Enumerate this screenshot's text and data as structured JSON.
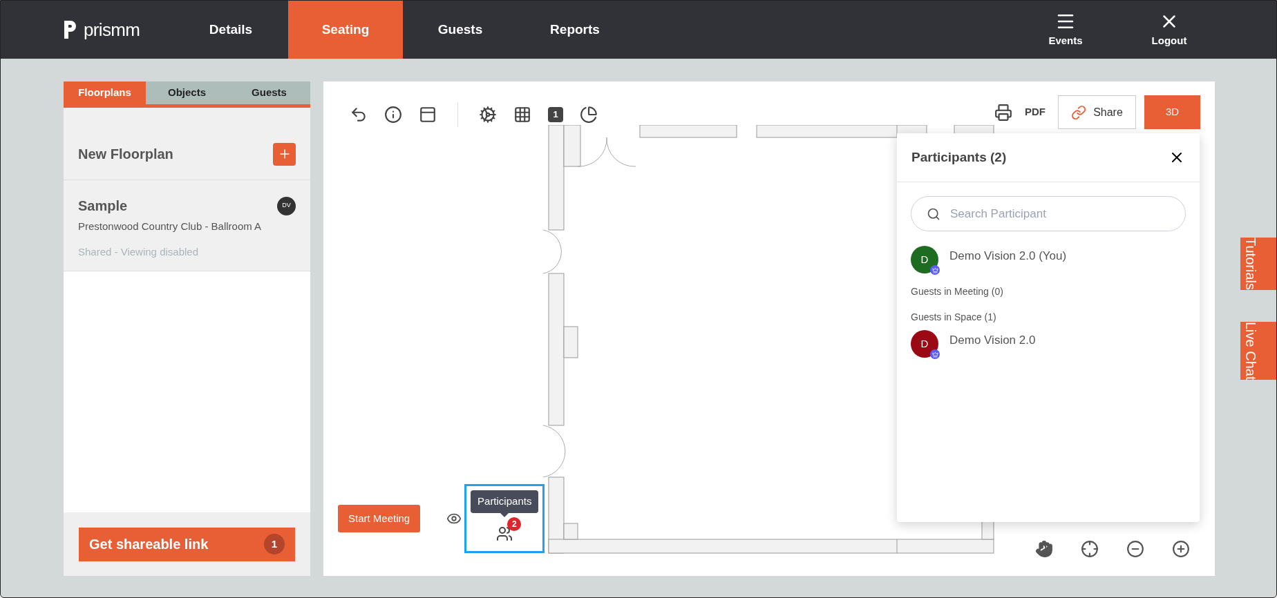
{
  "header": {
    "logo": "prismm",
    "nav": [
      {
        "label": "Details",
        "selected": false
      },
      {
        "label": "Seating",
        "selected": true
      },
      {
        "label": "Guests",
        "selected": false
      },
      {
        "label": "Reports",
        "selected": false
      }
    ],
    "actions": [
      {
        "kind": "menu",
        "label": "Events"
      },
      {
        "kind": "close",
        "label": "Logout"
      }
    ]
  },
  "left_panel": {
    "tabs": [
      {
        "label": "Floorplans",
        "selected": true
      },
      {
        "label": "Objects",
        "selected": false
      },
      {
        "label": "Guests",
        "selected": false
      }
    ],
    "new_floorplan": "New Floorplan",
    "floorplans": [
      {
        "name": "Sample",
        "initials": "DV",
        "venue": "Prestonwood Country Club - Ballroom A",
        "status": "Shared - Viewing disabled"
      }
    ],
    "share_button": {
      "label": "Get shareable link",
      "count": "1"
    }
  },
  "toolbar": {
    "layer": "1",
    "pdf": "PDF",
    "share": "Share",
    "view_3d": "3D"
  },
  "meeting": {
    "start": "Start Meeting",
    "tooltip": "Participants",
    "count": "2",
    "highlighted": true
  },
  "participants_panel": {
    "title": "Participants (2)",
    "search": {
      "placeholder": "Search Participant"
    },
    "hosts": [
      {
        "initial": "D",
        "name": "Demo Vision 2.0 (You)",
        "color": "#1e6b22"
      }
    ],
    "sections": [
      {
        "title": "Guests in Meeting (0)"
      },
      {
        "title": "Guests in Space (1)",
        "members": [
          {
            "initial": "D",
            "name": "Demo Vision 2.0",
            "color": "#9b0a14"
          }
        ]
      }
    ]
  },
  "side_tabs": [
    "Tutorials",
    "Live Chat"
  ]
}
